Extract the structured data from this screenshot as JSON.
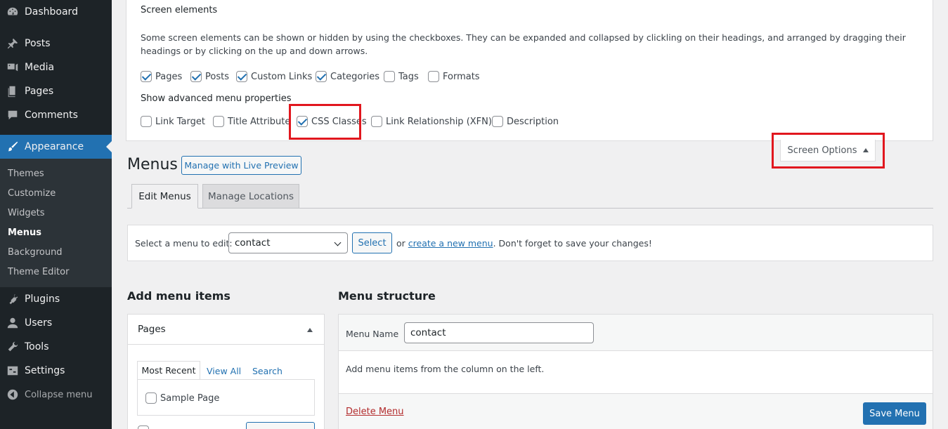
{
  "sidebar": {
    "items": [
      {
        "label": "Dashboard",
        "icon": "dashboard-icon"
      },
      {
        "label": "Posts",
        "icon": "pin-icon"
      },
      {
        "label": "Media",
        "icon": "media-icon"
      },
      {
        "label": "Pages",
        "icon": "pages-icon"
      },
      {
        "label": "Comments",
        "icon": "comments-icon"
      },
      {
        "label": "Appearance",
        "icon": "paintbrush-icon"
      },
      {
        "label": "Plugins",
        "icon": "plugin-icon"
      },
      {
        "label": "Users",
        "icon": "users-icon"
      },
      {
        "label": "Tools",
        "icon": "wrench-icon"
      },
      {
        "label": "Settings",
        "icon": "settings-icon"
      },
      {
        "label": "Collapse menu",
        "icon": "collapse-icon"
      }
    ],
    "submenu": [
      "Themes",
      "Customize",
      "Widgets",
      "Menus",
      "Background",
      "Theme Editor"
    ]
  },
  "screen_options": {
    "heading": "Screen elements",
    "description": "Some screen elements can be shown or hidden by using the checkboxes. They can be expanded and collapsed by clickling on their headings, and arranged by dragging their headings or by clicking on the up and down arrows.",
    "boxes": [
      {
        "label": "Pages",
        "checked": true
      },
      {
        "label": "Posts",
        "checked": true
      },
      {
        "label": "Custom Links",
        "checked": true
      },
      {
        "label": "Categories",
        "checked": true
      },
      {
        "label": "Tags",
        "checked": false
      },
      {
        "label": "Formats",
        "checked": false
      }
    ],
    "advanced_heading": "Show advanced menu properties",
    "advanced": [
      {
        "label": "Link Target",
        "checked": false
      },
      {
        "label": "Title Attribute",
        "checked": false
      },
      {
        "label": "CSS Classes",
        "checked": true
      },
      {
        "label": "Link Relationship (XFN)",
        "checked": false
      },
      {
        "label": "Description",
        "checked": false
      }
    ],
    "tab_label": "Screen Options"
  },
  "page": {
    "title": "Menus",
    "live_preview": "Manage with Live Preview",
    "tabs": [
      "Edit Menus",
      "Manage Locations"
    ]
  },
  "select_bar": {
    "label": "Select a menu to edit:",
    "selected": "contact",
    "button": "Select",
    "or": "or",
    "create_link": "create a new menu",
    "tail": ". Don't forget to save your changes!"
  },
  "add_items": {
    "title": "Add menu items",
    "panel_title": "Pages",
    "tabs": [
      "Most Recent",
      "View All",
      "Search"
    ],
    "items": [
      "Sample Page"
    ]
  },
  "structure": {
    "title": "Menu structure",
    "name_label": "Menu Name",
    "name_value": "contact",
    "body": "Add menu items from the column on the left.",
    "delete": "Delete Menu",
    "save": "Save Menu"
  },
  "colors": {
    "sidebar_bg": "#1d2327",
    "accent": "#2271b1",
    "highlight": "#e1171e",
    "delete": "#b32d2e"
  }
}
